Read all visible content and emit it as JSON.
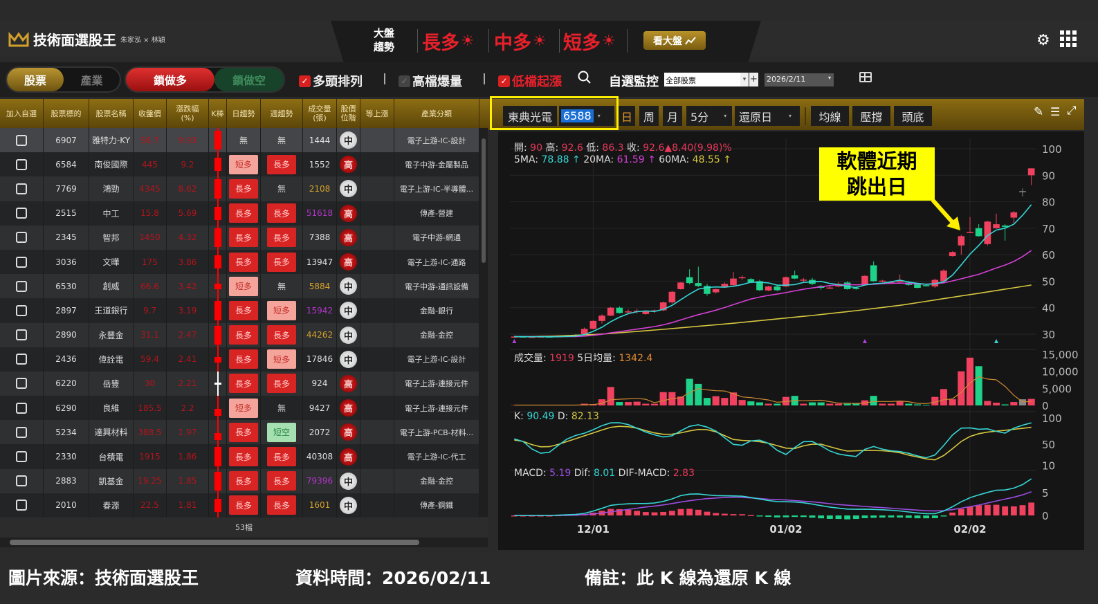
{
  "app": {
    "title": "技術面選股王",
    "subtitle": "朱家泓 × 林穎"
  },
  "market_trend": {
    "label_line1": "大盤",
    "label_line2": "趨勢",
    "items": [
      {
        "label": "長多",
        "icon": "sun-icon"
      },
      {
        "label": "中多",
        "icon": "sun-icon"
      },
      {
        "label": "短多",
        "icon": "sun-icon"
      }
    ],
    "sun_glyph": "☀",
    "see_market_button": "看大盤"
  },
  "toolbar": {
    "toggle_stock": "股票",
    "toggle_industry": "產業",
    "lock_long": "鎖做多",
    "lock_short": "鎖做空",
    "filters": [
      {
        "label": "多頭排列",
        "checked": true
      },
      {
        "label": "高檔爆量",
        "checked": false
      },
      {
        "label": "低檔起漲",
        "checked": true
      }
    ],
    "check_glyph": "✓",
    "separator": "|",
    "watch_label": "自選監控",
    "watch_value": "全部股票",
    "watch_plus": "+",
    "date_value": "2026/2/11"
  },
  "table": {
    "headers": [
      "加入自選",
      "股票標的",
      "股票名稱",
      "收盤價",
      "漲跌幅\n(%)",
      "K棒",
      "日趨勢",
      "週趨勢",
      "成交量\n(張)",
      "股價\n位階",
      "等上漲",
      "產業分類"
    ],
    "rows": [
      {
        "code": "6907",
        "name": "雅特力-KY",
        "close": "58.7",
        "change": "9.93",
        "kbar": "long",
        "day": "無",
        "week": "無",
        "volume": "1444",
        "vol_color": "#e0e0e0",
        "level": "中",
        "category": "電子上游-IC-設計"
      },
      {
        "code": "6584",
        "name": "南俊國際",
        "close": "445",
        "change": "9.2",
        "kbar": "mid",
        "day": "短多",
        "week": "長多",
        "volume": "1552",
        "vol_color": "#e0e0e0",
        "level": "高",
        "category": "電子中游-金屬製品"
      },
      {
        "code": "7769",
        "name": "鴻勁",
        "close": "4345",
        "change": "8.62",
        "kbar": "long",
        "day": "長多",
        "week": "無",
        "volume": "2108",
        "vol_color": "#d4a22a",
        "level": "中",
        "category": "電子上游-IC-半導體..."
      },
      {
        "code": "2515",
        "name": "中工",
        "close": "15.8",
        "change": "5.69",
        "kbar": "mid",
        "day": "長多",
        "week": "長多",
        "volume": "51618",
        "vol_color": "#b235c8",
        "level": "高",
        "category": "傳產-營建"
      },
      {
        "code": "2345",
        "name": "智邦",
        "close": "1450",
        "change": "4.32",
        "kbar": "long",
        "day": "長多",
        "week": "長多",
        "volume": "7388",
        "vol_color": "#e0e0e0",
        "level": "高",
        "category": "電子中游-網通"
      },
      {
        "code": "3036",
        "name": "文曄",
        "close": "175",
        "change": "3.86",
        "kbar": "mid",
        "day": "長多",
        "week": "長多",
        "volume": "13947",
        "vol_color": "#e0e0e0",
        "level": "高",
        "category": "電子上游-IC-通路"
      },
      {
        "code": "6530",
        "name": "創威",
        "close": "66.6",
        "change": "3.42",
        "kbar": "short",
        "day": "短多",
        "week": "無",
        "volume": "5884",
        "vol_color": "#d4a22a",
        "level": "中",
        "category": "電子中游-通訊設備"
      },
      {
        "code": "2897",
        "name": "王道銀行",
        "close": "9.7",
        "change": "3.19",
        "kbar": "long",
        "day": "長多",
        "week": "短多",
        "volume": "15942",
        "vol_color": "#b235c8",
        "level": "中",
        "category": "金融-銀行"
      },
      {
        "code": "2890",
        "name": "永豐金",
        "close": "31.1",
        "change": "2.47",
        "kbar": "long",
        "day": "長多",
        "week": "長多",
        "volume": "44262",
        "vol_color": "#d4a22a",
        "level": "中",
        "category": "金融-金控"
      },
      {
        "code": "2436",
        "name": "偉詮電",
        "close": "59.4",
        "change": "2.41",
        "kbar": "short",
        "day": "長多",
        "week": "短多",
        "volume": "17846",
        "vol_color": "#e0e0e0",
        "level": "中",
        "category": "電子上游-IC-設計"
      },
      {
        "code": "6220",
        "name": "岳豐",
        "close": "30",
        "change": "2.21",
        "kbar": "doji",
        "day": "長多",
        "week": "長多",
        "volume": "924",
        "vol_color": "#e0e0e0",
        "level": "高",
        "category": "電子上游-連接元件"
      },
      {
        "code": "6290",
        "name": "良維",
        "close": "185.5",
        "change": "2.2",
        "kbar": "low",
        "day": "短多",
        "week": "無",
        "volume": "9427",
        "vol_color": "#e0e0e0",
        "level": "高",
        "category": "電子上游-連接元件"
      },
      {
        "code": "5234",
        "name": "達興材料",
        "close": "388.5",
        "change": "1.97",
        "kbar": "low",
        "day": "長多",
        "week": "短空",
        "volume": "2072",
        "vol_color": "#e0e0e0",
        "level": "高",
        "category": "電子上游-PCB-材料..."
      },
      {
        "code": "2330",
        "name": "台積電",
        "close": "1915",
        "change": "1.86",
        "kbar": "long",
        "day": "長多",
        "week": "長多",
        "volume": "40308",
        "vol_color": "#e0e0e0",
        "level": "高",
        "category": "電子上游-IC-代工"
      },
      {
        "code": "2883",
        "name": "凱基金",
        "close": "19.25",
        "change": "1.85",
        "kbar": "long",
        "day": "長多",
        "week": "長多",
        "volume": "79396",
        "vol_color": "#b235c8",
        "level": "中",
        "category": "金融-金控"
      },
      {
        "code": "2010",
        "name": "春源",
        "close": "22.5",
        "change": "1.81",
        "kbar": "mid",
        "day": "長多",
        "week": "長多",
        "volume": "1601",
        "vol_color": "#d4a22a",
        "level": "中",
        "category": "傳產-鋼鐵"
      }
    ],
    "footer_count": "53檔"
  },
  "chart_toolbar": {
    "stock_name": "東典光電",
    "stock_code": "6588",
    "period_buttons": [
      "日",
      "周",
      "月"
    ],
    "active_period": "日",
    "interval": "5分",
    "adjust": "還原日",
    "tools": [
      "均線",
      "壓撐",
      "頭底"
    ]
  },
  "annotation": {
    "line1": "軟體近期",
    "line2": "跳出日",
    "bg": "#ffff00"
  },
  "chart_data": {
    "type": "candlestick",
    "info_line1": [
      {
        "label": "開: ",
        "value": "90",
        "color": "#e8385a"
      },
      {
        "label": " 高: ",
        "value": "92.6",
        "color": "#e8385a"
      },
      {
        "label": " 低: ",
        "value": "86.3",
        "color": "#e8385a"
      },
      {
        "label": " 收: ",
        "value": "92.6▲8.40(9.98)%",
        "color": "#e8385a"
      }
    ],
    "info_line2": [
      {
        "label": "5MA: ",
        "value": "78.88 ↑",
        "color": "#36d6d6"
      },
      {
        "label": " 20MA: ",
        "value": "61.59 ↑",
        "color": "#d640d6"
      },
      {
        "label": " 60MA: ",
        "value": "48.55 ↑",
        "color": "#d6c640"
      }
    ],
    "volume_info": [
      {
        "label": "成交量: ",
        "value": "1919",
        "color": "#e8385a"
      },
      {
        "label": " 5日均量: ",
        "value": "1342.4",
        "color": "#e08a30"
      }
    ],
    "kd_info": [
      {
        "label": "K: ",
        "value": "90.49",
        "color": "#36d6d6"
      },
      {
        "label": " D: ",
        "value": "82.13",
        "color": "#d6c640"
      }
    ],
    "macd_info": [
      {
        "label": "MACD: ",
        "value": "5.19",
        "color": "#9b4de0"
      },
      {
        "label": " Dif: ",
        "value": "8.01",
        "color": "#36d6d6"
      },
      {
        "label": " DIF-MACD: ",
        "value": "2.83",
        "color": "#e8385a"
      }
    ],
    "colors": {
      "up": "#f0415f",
      "down": "#1ed28a",
      "flat": "#888888",
      "ma5": "#36d6d6",
      "ma20": "#d640d6",
      "ma60": "#d6c640",
      "vol_ma": "#d08a30",
      "k": "#36d6d6",
      "d": "#d6c640",
      "dif": "#36d6d6",
      "macd": "#9b4de0"
    },
    "price_axis": {
      "ticks": [
        100,
        90,
        80,
        70,
        60,
        50,
        40,
        30
      ],
      "range": [
        27.5,
        101.5
      ]
    },
    "volume_axis": {
      "ticks": [
        "15,000",
        "10,000",
        "5,000",
        "0"
      ],
      "values": [
        15000,
        10000,
        5000,
        0
      ]
    },
    "kd_axis": {
      "ticks": [
        100,
        50,
        10
      ]
    },
    "macd_axis": {
      "ticks": [
        5,
        0
      ]
    },
    "x_labels": [
      {
        "label": "12/01",
        "index": 9
      },
      {
        "label": "01/02",
        "index": 31
      },
      {
        "label": "02/02",
        "index": 52
      }
    ],
    "candles": [
      [
        29,
        29.4,
        28.7,
        29.1
      ],
      [
        29.1,
        29.3,
        28.8,
        28.9
      ],
      [
        28.9,
        29.2,
        28.6,
        29
      ],
      [
        29,
        29.3,
        28.8,
        29.1
      ],
      [
        29.1,
        29.4,
        28.9,
        29
      ],
      [
        29,
        29.5,
        28.8,
        29.2
      ],
      [
        29.2,
        29.6,
        28.9,
        29.4
      ],
      [
        29.4,
        30,
        29,
        29.6
      ],
      [
        30,
        32.5,
        29.8,
        32
      ],
      [
        32,
        35.2,
        31.8,
        35
      ],
      [
        35,
        37.5,
        34,
        37
      ],
      [
        37,
        40.3,
        36.8,
        40
      ],
      [
        40,
        40.5,
        37.8,
        38
      ],
      [
        38.5,
        39.3,
        37.5,
        38.6
      ],
      [
        38.5,
        39.5,
        37.8,
        38.8
      ],
      [
        37.6,
        38.8,
        37.3,
        38.5
      ],
      [
        38.8,
        39.3,
        38,
        39
      ],
      [
        39,
        42.3,
        38.7,
        42
      ],
      [
        42,
        46.3,
        41.5,
        46
      ],
      [
        47,
        49.7,
        46.8,
        49.5
      ],
      [
        51.5,
        54.5,
        48.8,
        49.3
      ],
      [
        49.3,
        55.5,
        47.8,
        48.2
      ],
      [
        48.2,
        49,
        44.5,
        45.2
      ],
      [
        45.8,
        47.2,
        45.3,
        47
      ],
      [
        48,
        49.5,
        47.5,
        49
      ],
      [
        48.5,
        53.5,
        48.2,
        51
      ],
      [
        51.3,
        52.2,
        50.5,
        51.5
      ],
      [
        50.8,
        51.2,
        49.3,
        49.7
      ],
      [
        50,
        50.5,
        46.3,
        46.6
      ],
      [
        46.5,
        48.3,
        46.2,
        48
      ],
      [
        48,
        48.5,
        46.2,
        46.6
      ],
      [
        48,
        51.8,
        47.8,
        51.5
      ],
      [
        52.2,
        54,
        50.8,
        51
      ],
      [
        50.5,
        51.2,
        49.8,
        50.6
      ],
      [
        50.5,
        51.3,
        48.5,
        49
      ],
      [
        48.2,
        48.6,
        46.8,
        47.5
      ],
      [
        47.5,
        48.2,
        47,
        47.6
      ],
      [
        48,
        49.6,
        47.7,
        49
      ],
      [
        49.5,
        50,
        46.8,
        47
      ],
      [
        47.5,
        48,
        46.8,
        47.1
      ],
      [
        48.6,
        52.3,
        48.3,
        52
      ],
      [
        56,
        57.5,
        49.8,
        50
      ],
      [
        50,
        50.5,
        49.6,
        50.2
      ],
      [
        49.5,
        50,
        49,
        49.6
      ],
      [
        50,
        52.5,
        49.5,
        50.1
      ],
      [
        49.5,
        50,
        48.3,
        48.6
      ],
      [
        49,
        49.3,
        47.3,
        47.5
      ],
      [
        48.5,
        49,
        48,
        48.4
      ],
      [
        48,
        51,
        47.5,
        50.5
      ],
      [
        50,
        54.5,
        49.8,
        54
      ],
      [
        59.5,
        61.3,
        59.3,
        61
      ],
      [
        63.5,
        67.5,
        60,
        67
      ],
      [
        68.5,
        74.2,
        68.2,
        68.6
      ],
      [
        70,
        71.5,
        66.8,
        67
      ],
      [
        64,
        72.8,
        63.5,
        72.5
      ],
      [
        70,
        75.5,
        69.8,
        71.5
      ],
      [
        71,
        71.5,
        65.3,
        70.5
      ],
      [
        74,
        76.5,
        72,
        76
      ],
      [
        84,
        85,
        82,
        84
      ],
      [
        90,
        92.6,
        86.3,
        92.6
      ]
    ],
    "ma60": [
      29,
      29.3,
      30,
      31.2,
      32.6,
      34,
      35.6,
      37.2,
      39,
      41,
      43.5,
      46,
      48.55
    ],
    "volume": [
      100,
      100,
      100,
      100,
      100,
      100,
      100,
      100,
      500,
      400,
      1800,
      5400,
      1000,
      1000,
      1100,
      500,
      500,
      3900,
      3900,
      2600,
      7800,
      6300,
      2200,
      2700,
      2200,
      3800,
      1600,
      1200,
      900,
      500,
      500,
      2500,
      2800,
      500,
      900,
      900,
      500,
      500,
      500,
      500,
      1500,
      2800,
      500,
      500,
      1200,
      500,
      300,
      200,
      2500,
      4800,
      1800,
      10000,
      14000,
      11500,
      1300,
      800,
      300,
      1000,
      1800,
      1919
    ],
    "k": [
      60,
      55,
      40,
      32,
      35,
      50,
      62,
      68,
      72,
      80,
      88,
      92,
      90,
      85,
      76,
      70,
      65,
      62,
      72,
      82,
      88,
      84,
      78,
      65,
      50,
      47,
      56,
      58,
      52,
      38,
      30,
      45,
      56,
      55,
      45,
      35,
      30,
      28,
      26,
      48,
      44,
      38,
      37,
      35,
      30,
      25,
      23,
      40,
      62,
      80,
      82,
      78,
      80,
      75,
      70,
      80,
      86,
      90.49
    ],
    "d": [
      58,
      55,
      48,
      44,
      46,
      52,
      58,
      64,
      70,
      76,
      82,
      84,
      83,
      80,
      74,
      70,
      68,
      70,
      74,
      78,
      78,
      74,
      66,
      58,
      57,
      56,
      54,
      50,
      44,
      40,
      46,
      50,
      50,
      45,
      40,
      36,
      38,
      38,
      38,
      37,
      35,
      30,
      26,
      22,
      20,
      30,
      45,
      60,
      68,
      72,
      74,
      76,
      78,
      80,
      82.13
    ],
    "dif": [
      0,
      0,
      0,
      0,
      0.1,
      0.2,
      0.5,
      1.3,
      2.2,
      2.5,
      2.6,
      2.6,
      2.8,
      3.5,
      4.5,
      4.8,
      4.5,
      4.3,
      4.3,
      4.2,
      3.8,
      3.3,
      3.0,
      3.0,
      2.8,
      2.4,
      1.9,
      1.6,
      1.3,
      1.4,
      1.3,
      1.2,
      1.0,
      0.7,
      0.4,
      0.4,
      1.2,
      2.8,
      4.0,
      4.8,
      5.5,
      5.6,
      6.3,
      8.01
    ],
    "macd": [
      0,
      0,
      0,
      0,
      0,
      0.1,
      0.3,
      0.6,
      1.0,
      1.4,
      1.8,
      2.1,
      2.5,
      3.0,
      3.4,
      3.7,
      3.9,
      4.0,
      3.9,
      3.7,
      3.5,
      3.4,
      3.2,
      3.0,
      2.7,
      2.4,
      2.2,
      2.0,
      1.8,
      1.6,
      1.4,
      1.2,
      1.0,
      1.0,
      1.3,
      1.8,
      2.3,
      3.0,
      3.6,
      4.2,
      5.19
    ]
  },
  "caption": {
    "source": "圖片來源：技術面選股王",
    "data_time": "資料時間：2026/02/11",
    "note": "備註：此 K 線為還原 K 線"
  }
}
